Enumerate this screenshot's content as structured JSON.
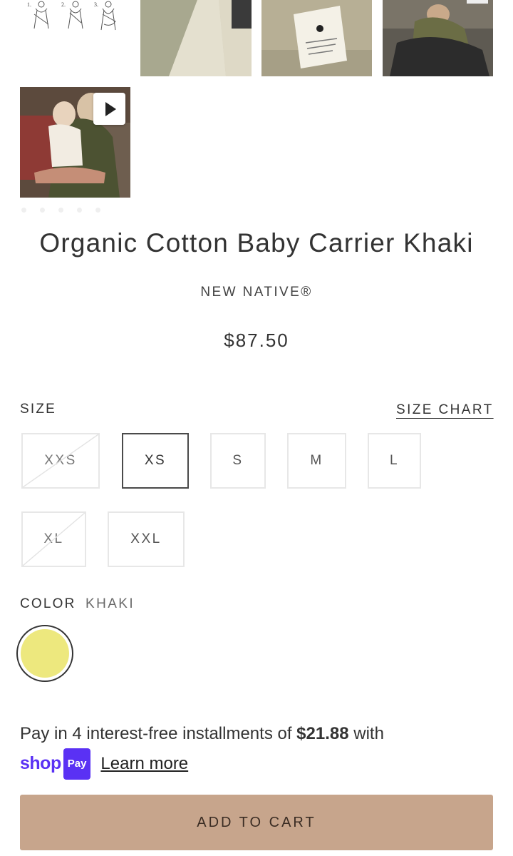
{
  "product": {
    "title": "Organic Cotton Baby Carrier Khaki",
    "vendor": "NEW NATIVE®",
    "price": "$87.50"
  },
  "gallery": {
    "instruction_numbers": [
      "1.",
      "2.",
      "3."
    ],
    "play_icon": "play-icon",
    "dot_count": 5
  },
  "size": {
    "label": "SIZE",
    "chart_link": "SIZE CHART",
    "selected": "XS",
    "options": [
      {
        "label": "XXS",
        "available": false
      },
      {
        "label": "XS",
        "available": true
      },
      {
        "label": "S",
        "available": true
      },
      {
        "label": "M",
        "available": true
      },
      {
        "label": "L",
        "available": true
      },
      {
        "label": "XL",
        "available": false
      },
      {
        "label": "XXL",
        "available": true
      }
    ]
  },
  "color": {
    "label": "COLOR",
    "value": "KHAKI",
    "swatch_hex": "#ede87e"
  },
  "installments": {
    "prefix": "Pay in 4 interest-free installments of ",
    "amount": "$21.88",
    "suffix": " with",
    "shop_logo": "shop",
    "pay_badge": "Pay",
    "learn_more": "Learn more"
  },
  "cart": {
    "button_label": "ADD TO CART",
    "button_color": "#c7a58c"
  }
}
